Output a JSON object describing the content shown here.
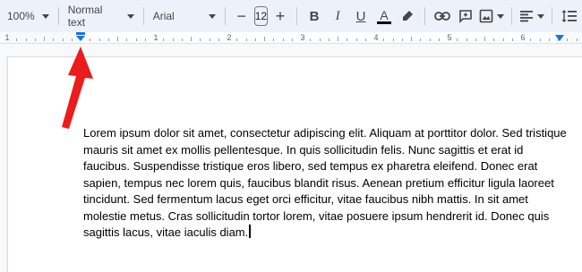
{
  "toolbar": {
    "zoom": "100%",
    "paragraph_style": "Normal text",
    "font": "Arial",
    "font_size": "12",
    "decrease": "−",
    "increase": "+",
    "bold": "B",
    "italic": "I",
    "underline": "U",
    "text_color": "A",
    "text_color_underline": "#000000"
  },
  "ruler": {
    "numbers": [
      "1",
      "1",
      "2",
      "3",
      "4",
      "5",
      "6"
    ],
    "marker_color": "#1a73e8"
  },
  "document": {
    "paragraph": "Lorem ipsum dolor sit amet, consectetur adipiscing elit. Aliquam at porttitor dolor. Sed tristique mauris sit amet ex mollis pellentesque. In quis sollicitudin felis. Nunc sagittis et erat id faucibus. Suspendisse tristique eros libero, sed tempus ex pharetra eleifend. Donec erat sapien, tempus nec lorem quis, faucibus blandit risus. Aenean pretium efficitur ligula laoreet tincidunt. Sed fermentum lacus eget orci efficitur, vitae faucibus nibh mattis. In sit amet molestie metus. Cras sollicitudin tortor lorem, vitae posuere ipsum hendrerit id. Donec quis sagittis lacus, vitae iaculis diam."
  },
  "annotation": {
    "arrow_color": "#ea1c1c"
  }
}
